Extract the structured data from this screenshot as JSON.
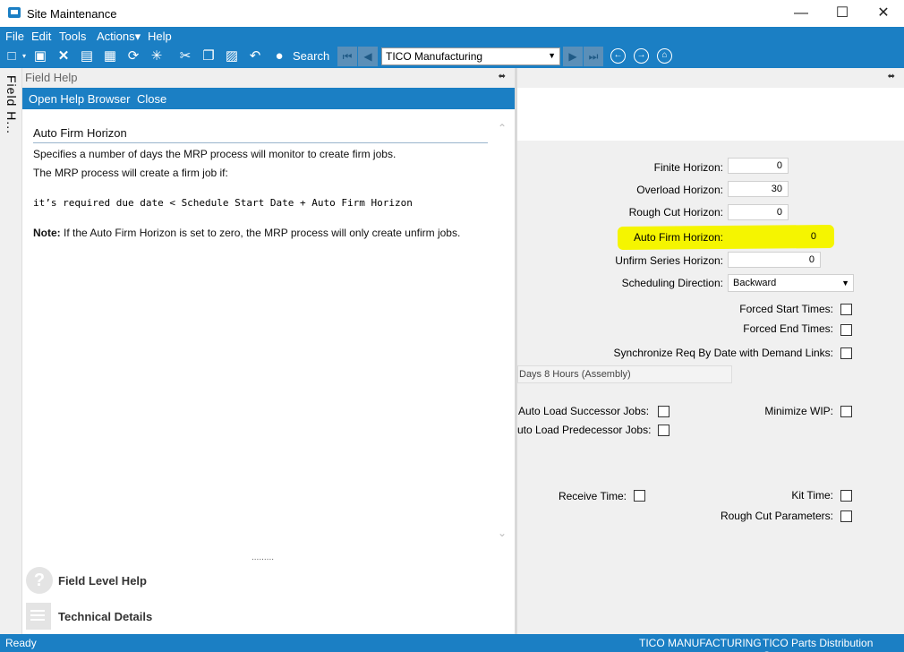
{
  "window": {
    "title": "Site Maintenance",
    "minimize": "—",
    "maximize": "☐",
    "close": "✕"
  },
  "menu": {
    "items": [
      "File",
      "Edit",
      "Tools",
      "Actions▾",
      "Help"
    ]
  },
  "toolbar": {
    "search_label": "Search",
    "company": "TICO Manufacturing",
    "icons": [
      "new-icon",
      "save-icon",
      "delete-icon",
      "book-icon",
      "attachment-icon",
      "refresh-icon",
      "clear-icon",
      "cut-icon",
      "copy-icon",
      "paste-icon",
      "undo-icon",
      "binoculars-icon"
    ]
  },
  "vertical_tab": {
    "label": "Field H..."
  },
  "field_help": {
    "header": "Field Help",
    "actions": [
      "Open Help Browser",
      "Close"
    ],
    "title": "Auto Firm Horizon",
    "line1": "Specifies a number of days the MRP process will monitor to create firm jobs.",
    "line2": "The MRP process will create a firm job if:",
    "formula": "it’s required due date < Schedule Start Date + Auto Firm Horizon",
    "note_label": "Note:",
    "note_text": " If the Auto Firm Horizon is set to zero, the MRP process will only create unfirm jobs.",
    "grip": ".........",
    "links": {
      "field_level": "Field Level Help",
      "technical": "Technical Details"
    }
  },
  "form": {
    "finite_horizon": {
      "label": "Finite Horizon:",
      "value": "0"
    },
    "overload_horizon": {
      "label": "Overload Horizon:",
      "value": "30"
    },
    "rough_cut_horizon": {
      "label": "Rough Cut Horizon:",
      "value": "0"
    },
    "auto_firm_horizon": {
      "label": "Auto Firm Horizon:",
      "value": "0"
    },
    "unfirm_series_horizon": {
      "label": "Unfirm Series Horizon:",
      "value": "0"
    },
    "scheduling_direction": {
      "label": "Scheduling Direction:",
      "value": "Backward"
    },
    "forced_start_times": {
      "label": "Forced Start Times:",
      "checked": false
    },
    "forced_end_times": {
      "label": "Forced End Times:",
      "checked": false
    },
    "sync_req_by_date": {
      "label": "Synchronize Req By Date with Demand Links:",
      "checked": false
    },
    "days_field": "Days 8 Hours (Assembly)",
    "auto_load_successor": {
      "label": "Auto Load Successor Jobs:",
      "checked": false
    },
    "auto_load_predecessor": {
      "label": "uto Load Predecessor Jobs:",
      "checked": false
    },
    "minimize_wip": {
      "label": "Minimize WIP:",
      "checked": false
    },
    "receive_time": {
      "label": "Receive Time:",
      "checked": false
    },
    "kit_time": {
      "label": "Kit Time:",
      "checked": false
    },
    "rough_cut_parameters": {
      "label": "Rough Cut Parameters:",
      "checked": false
    }
  },
  "status": {
    "left": "Ready",
    "company": "TICO MANUFACTURING",
    "site": "TICO Parts Distribution Center"
  },
  "colors": {
    "accent": "#1b7fc4",
    "highlight": "#f5f500"
  }
}
